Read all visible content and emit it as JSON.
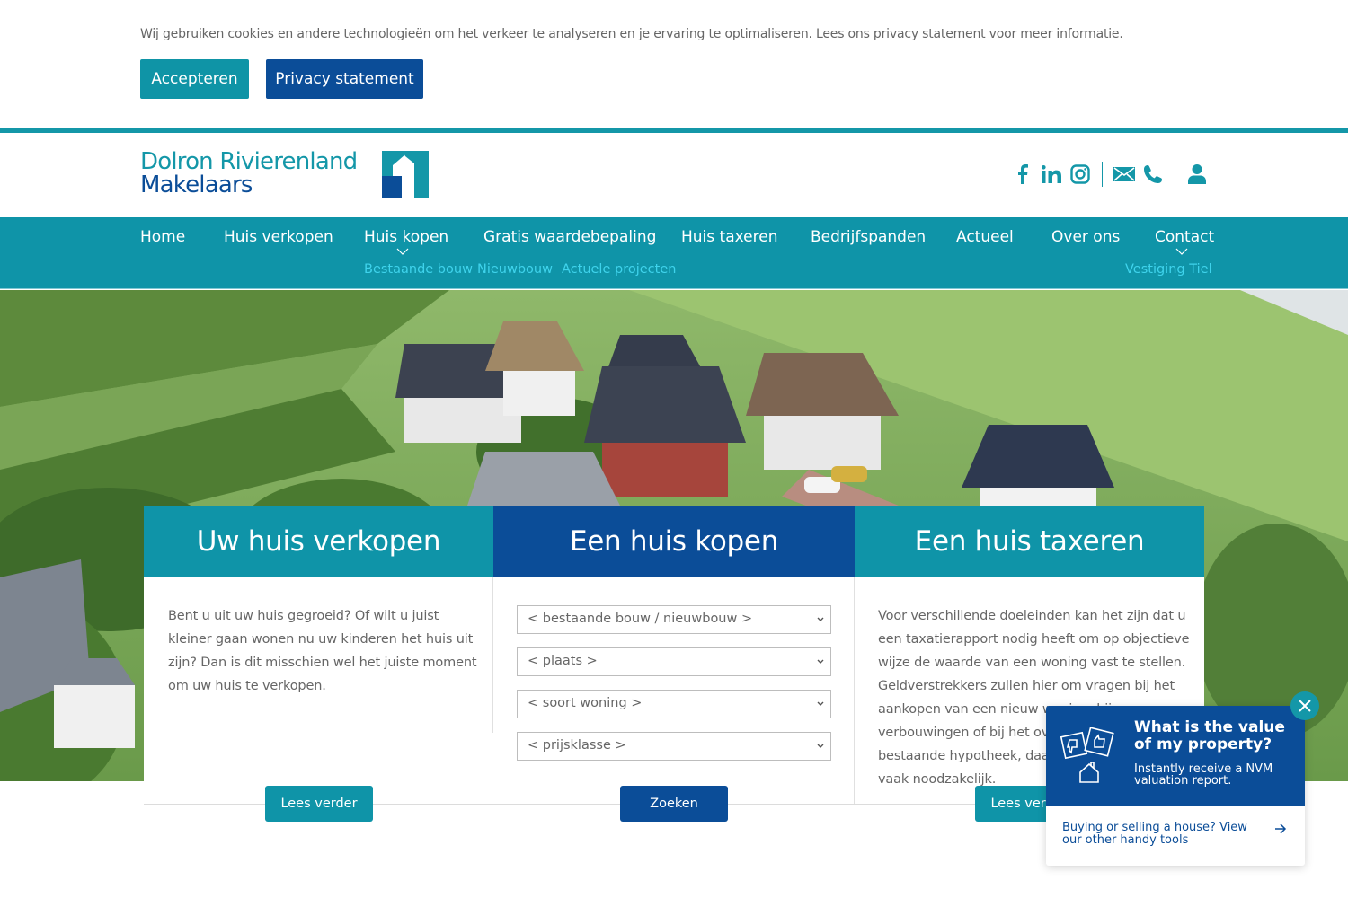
{
  "cookie_bar": {
    "message": "Wij gebruiken cookies en andere technologieën om het verkeer te analyseren en je ervaring te optimaliseren. Lees ons privacy statement voor meer informatie.",
    "accept_label": "Accepteren",
    "privacy_label": "Privacy statement"
  },
  "header": {
    "logo_line1": "Dolron Rivierenland",
    "logo_line2": "Makelaars",
    "icons": [
      "facebook-icon",
      "linkedin-icon",
      "instagram-icon",
      "mail-icon",
      "phone-icon",
      "user-icon"
    ]
  },
  "nav": {
    "items": [
      {
        "label": "Home"
      },
      {
        "label": "Huis verkopen"
      },
      {
        "label": "Huis kopen",
        "submenu": [
          "Bestaande bouw",
          "Nieuwbouw",
          "Actuele projecten"
        ]
      },
      {
        "label": "Gratis waardebepaling"
      },
      {
        "label": "Huis taxeren"
      },
      {
        "label": "Bedrijfspanden"
      },
      {
        "label": "Actueel"
      },
      {
        "label": "Over ons"
      },
      {
        "label": "Contact",
        "submenu": [
          "Vestiging Tiel"
        ]
      }
    ]
  },
  "cards": [
    {
      "title": "Uw huis verkopen",
      "text": "Bent u uit uw huis gegroeid? Of wilt u juist kleiner gaan wonen nu uw kinderen het huis uit zijn? Dan is dit misschien wel het juiste moment om uw huis te verkopen.",
      "button": "Lees verder"
    },
    {
      "title": "Een huis kopen",
      "selects": [
        {
          "value": "< bestaande bouw / nieuwbouw >"
        },
        {
          "value": "< plaats >"
        },
        {
          "value": "< soort woning >"
        },
        {
          "value": "< prijsklasse >"
        }
      ],
      "button": "Zoeken"
    },
    {
      "title": "Een huis taxeren",
      "text": "Voor verschillende doeleinden kan het zijn dat u een taxatierapport nodig heeft om op objectieve wijze de waarde van een woning vast te stellen. Geldverstrekkers zullen hier om vragen bij het aankopen van een nieuw woning, bij verbouwingen of bij het oversluiten van uw bestaande hypotheek, daarom is een taxatie vaak noodzakelijk.",
      "button": "Lees verder"
    }
  ],
  "widget": {
    "title": "What is the value of my property?",
    "subtitle": "Instantly receive a NVM valuation report.",
    "link": "Buying or selling a house? View our other handy tools"
  },
  "colors": {
    "teal": "#0f94a8",
    "navy": "#0b4d98",
    "submenu": "#3fd3ec"
  }
}
